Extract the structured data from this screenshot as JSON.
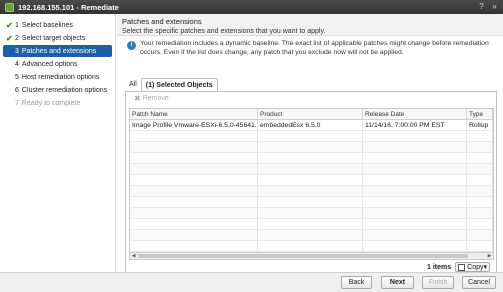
{
  "window": {
    "title": "192.168.155.101 - Remediate"
  },
  "sidebar": {
    "steps": [
      {
        "num": "1",
        "label": "Select baselines",
        "state": "done"
      },
      {
        "num": "2",
        "label": "Select target objects",
        "state": "done"
      },
      {
        "num": "3",
        "label": "Patches and extensions",
        "state": "active"
      },
      {
        "num": "4",
        "label": "Advanced options",
        "state": "pending"
      },
      {
        "num": "5",
        "label": "Host remediation options",
        "state": "pending"
      },
      {
        "num": "6",
        "label": "Cluster remediation options",
        "state": "pending"
      },
      {
        "num": "7",
        "label": "Ready to complete",
        "state": "disabled"
      }
    ]
  },
  "content": {
    "title": "Patches and extensions",
    "subtitle": "Select the specific patches and extensions that you want to apply.",
    "notice": "Your remediation includes a dynamic baseline. The exact list of applicable patches might change before remediation occurs. Even if the list does change, any patch that you exclude now will not be applied."
  },
  "tabs": {
    "all": "All",
    "selected": "(1) Selected Objects"
  },
  "toolbar": {
    "remove_label": "Remove"
  },
  "grid": {
    "columns": [
      "Patch Name",
      "Product",
      "Release Date",
      "Type"
    ],
    "rows": [
      [
        "Image Profile Vmware-ESXi-6.5.0-45641...",
        "embeddedEsx 6.5.0",
        "11/14/16, 7:00:00 PM EST",
        "Rollup"
      ]
    ]
  },
  "status": {
    "count": "1 items",
    "copy_label": "Copy"
  },
  "footer": {
    "back": "Back",
    "next": "Next",
    "finish": "Finish",
    "cancel": "Cancel"
  }
}
